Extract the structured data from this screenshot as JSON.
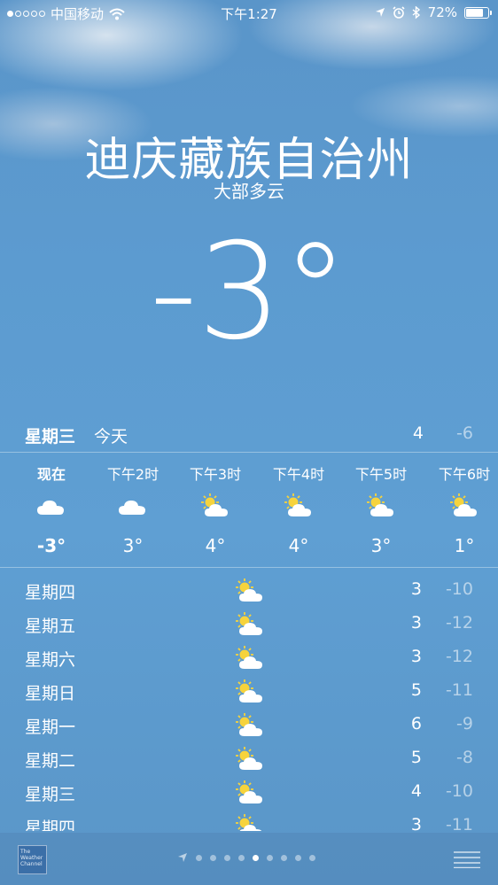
{
  "status_bar": {
    "carrier": "中国移动",
    "time": "下午1:27",
    "battery": "72%",
    "battery_level": 0.72,
    "icons": [
      "signal-dots-icon",
      "wifi-icon",
      "location-icon",
      "alarm-icon",
      "bluetooth-icon",
      "battery-icon"
    ]
  },
  "current": {
    "city": "迪庆藏族自治州",
    "condition": "大部多云",
    "temperature": "-3°"
  },
  "today": {
    "day": "星期三",
    "label": "今天",
    "high": "4",
    "low": "-6"
  },
  "hourly": [
    {
      "time": "现在",
      "icon": "cloud-icon",
      "temp": "-3°"
    },
    {
      "time": "下午2时",
      "icon": "cloud-icon",
      "temp": "3°"
    },
    {
      "time": "下午3时",
      "icon": "partly-sunny-icon",
      "temp": "4°"
    },
    {
      "time": "下午4时",
      "icon": "partly-sunny-icon",
      "temp": "4°"
    },
    {
      "time": "下午5时",
      "icon": "partly-sunny-icon",
      "temp": "3°"
    },
    {
      "time": "下午6时",
      "icon": "partly-sunny-icon",
      "temp": "1°"
    }
  ],
  "daily": [
    {
      "day": "星期四",
      "icon": "partly-sunny-icon",
      "high": "3",
      "low": "-10"
    },
    {
      "day": "星期五",
      "icon": "partly-sunny-icon",
      "high": "3",
      "low": "-12"
    },
    {
      "day": "星期六",
      "icon": "partly-sunny-icon",
      "high": "3",
      "low": "-12"
    },
    {
      "day": "星期日",
      "icon": "partly-sunny-icon",
      "high": "5",
      "low": "-11"
    },
    {
      "day": "星期一",
      "icon": "partly-sunny-icon",
      "high": "6",
      "low": "-9"
    },
    {
      "day": "星期二",
      "icon": "partly-sunny-icon",
      "high": "5",
      "low": "-8"
    },
    {
      "day": "星期三",
      "icon": "partly-sunny-icon",
      "high": "4",
      "low": "-10"
    },
    {
      "day": "星期四",
      "icon": "partly-sunny-icon",
      "high": "3",
      "low": "-11"
    }
  ],
  "bottom_bar": {
    "logo_text": "The Weather Channel",
    "page_count": 9,
    "active_page": 4
  }
}
